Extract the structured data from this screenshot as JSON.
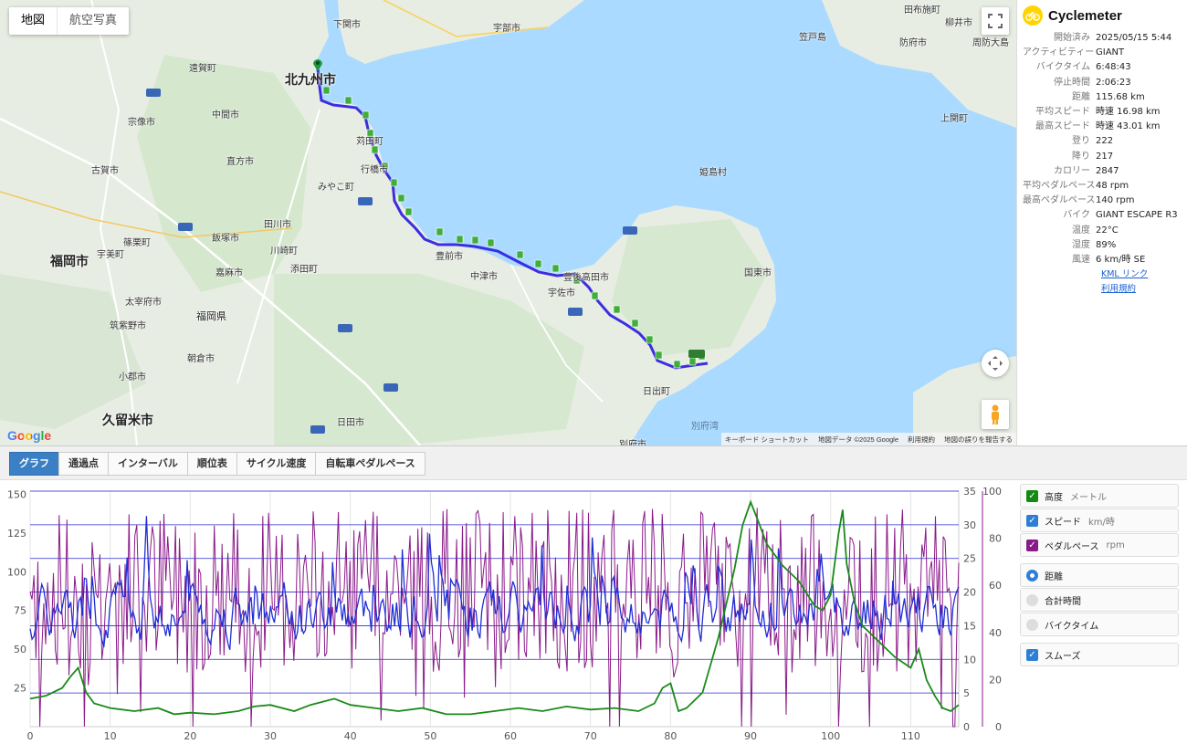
{
  "map": {
    "type_buttons": [
      {
        "label": "地図",
        "active": true
      },
      {
        "label": "航空写真",
        "active": false
      }
    ],
    "labels": {
      "kitakyushu": "北九州市",
      "shimonoseki": "下関市",
      "fukuoka": "福岡市",
      "kurume": "久留米市",
      "nakatsu": "中津市",
      "buzen": "豊前市",
      "usa": "宇佐市",
      "bungotakada": "豊後高田市",
      "kunisaki": "国東市",
      "hiji": "日出町",
      "beppu": "別府市",
      "yukuhashi": "行橋市",
      "kanda": "苅田町",
      "miyako": "みやこ町",
      "fukuoka_pref": "福岡県",
      "himeshima": "姫島村",
      "ube": "宇部市",
      "hofu": "防府市",
      "yanai": "柳井市",
      "iizuka": "飯塚市",
      "nogata": "直方市",
      "munakata": "宗像市",
      "koga": "古賀市",
      "dazaifu": "太宰府市",
      "asakura": "朝倉市",
      "hita": "日田市",
      "ogori": "小郡市",
      "chikushino": "筑紫野市",
      "tagawa": "田川市",
      "nakama": "中間市",
      "onga": "遠賀町",
      "kasuya": "篠栗町",
      "umi": "宇美町",
      "kama": "嘉麻市",
      "soeda": "添田町",
      "kawasaki": "川崎町",
      "kanmon": "山陽道",
      "kasado": "笠戸島",
      "tabuse": "田布施町",
      "kaminoseki": "上関町",
      "suo": "周防大島",
      "kakusa": "杵築市",
      "beppu_bay": "別府湾"
    },
    "attribution": {
      "shortcuts": "キーボード ショートカット",
      "data": "地図データ ©2025 Google",
      "terms": "利用規約",
      "report": "地図の誤りを報告する"
    },
    "google": "Google"
  },
  "info": {
    "brand": "Cyclemeter",
    "stats": [
      {
        "k": "開始済み",
        "v": "2025/05/15 5:44"
      },
      {
        "k": "アクティビティー",
        "v": "GIANT"
      },
      {
        "k": "バイクタイム",
        "v": "6:48:43"
      },
      {
        "k": "停止時間",
        "v": "2:06:23"
      },
      {
        "k": "距離",
        "v": "115.68 km"
      },
      {
        "k": "平均スピード",
        "v": "時速 16.98 km"
      },
      {
        "k": "最高スピード",
        "v": "時速 43.01 km"
      },
      {
        "k": "登り",
        "v": "222"
      },
      {
        "k": "降り",
        "v": "217"
      },
      {
        "k": "カロリー",
        "v": "2847"
      },
      {
        "k": "平均ペダルペース",
        "v": "48 rpm"
      },
      {
        "k": "最高ペダルペース",
        "v": "140 rpm"
      },
      {
        "k": "バイク",
        "v": "GIANT ESCAPE R3"
      },
      {
        "k": "温度",
        "v": "22°C"
      },
      {
        "k": "湿度",
        "v": "89%"
      },
      {
        "k": "風速",
        "v": "6 km/時 SE"
      }
    ],
    "links": [
      "KML リンク",
      "利用規約"
    ]
  },
  "tabs": [
    {
      "label": "グラフ",
      "active": true
    },
    {
      "label": "通過点",
      "active": false
    },
    {
      "label": "インターバル",
      "active": false
    },
    {
      "label": "順位表",
      "active": false
    },
    {
      "label": "サイクル速度",
      "active": false
    },
    {
      "label": "自転車ペダルペース",
      "active": false
    }
  ],
  "side": {
    "series": [
      {
        "label": "高度",
        "unit": "メートル",
        "color": "#138a13"
      },
      {
        "label": "スピード",
        "unit": "km/時",
        "color": "#2e7fd4"
      },
      {
        "label": "ペダルペース",
        "unit": "rpm",
        "color": "#8a1a8a"
      }
    ],
    "axis_options": [
      {
        "label": "距離",
        "selected": true
      },
      {
        "label": "合計時間",
        "selected": false
      },
      {
        "label": "バイクタイム",
        "selected": false
      }
    ],
    "smooth": {
      "label": "スムーズ",
      "checked": true
    }
  },
  "chart_data": {
    "type": "line",
    "x_ticks": [
      0,
      10,
      20,
      30,
      40,
      50,
      60,
      70,
      80,
      90,
      100,
      110
    ],
    "xlim": [
      0,
      116
    ],
    "left_axis": {
      "ticks": [
        25,
        50,
        75,
        100,
        125,
        150
      ],
      "ylim": [
        0,
        152
      ]
    },
    "right_axis_speed": {
      "ticks": [
        0,
        5,
        10,
        15,
        20,
        25,
        30,
        35
      ],
      "ylim": [
        0,
        35
      ]
    },
    "right_axis_cadence": {
      "ticks": [
        0,
        20,
        40,
        60,
        80,
        100
      ],
      "ylim": [
        0,
        100
      ]
    },
    "series": [
      {
        "name": "高度",
        "color": "#1a8a1a",
        "axis": "left",
        "x": [
          0,
          2,
          4,
          5,
          6,
          7,
          8,
          10,
          13,
          16,
          18,
          20,
          23,
          26,
          28,
          30,
          33,
          35,
          38,
          40,
          43,
          46,
          49,
          52,
          55,
          58,
          61,
          64,
          67,
          70,
          73,
          76,
          78,
          79,
          80,
          81,
          82,
          84,
          86,
          88,
          89,
          90,
          91,
          92,
          94,
          96,
          98,
          99,
          100,
          101,
          101.5,
          102,
          103,
          104,
          106,
          108,
          110,
          111,
          112,
          113,
          114,
          115,
          116
        ],
        "y": [
          18,
          20,
          25,
          32,
          38,
          22,
          15,
          12,
          10,
          12,
          8,
          9,
          8,
          10,
          13,
          14,
          10,
          14,
          18,
          14,
          12,
          10,
          12,
          8,
          8,
          10,
          12,
          10,
          13,
          11,
          12,
          10,
          15,
          25,
          28,
          10,
          12,
          22,
          58,
          102,
          130,
          145,
          132,
          118,
          104,
          94,
          78,
          75,
          85,
          125,
          140,
          105,
          80,
          65,
          55,
          45,
          38,
          50,
          30,
          20,
          12,
          10,
          14
        ]
      },
      {
        "name": "スピード",
        "color": "#1f2fd6",
        "axis": "right_speed",
        "y_mean": 16.98,
        "y_max": 43.01
      },
      {
        "name": "ペダルペース",
        "color": "#8a1a8a",
        "axis": "right_cadence",
        "y_mean": 48,
        "y_max": 140
      }
    ]
  }
}
